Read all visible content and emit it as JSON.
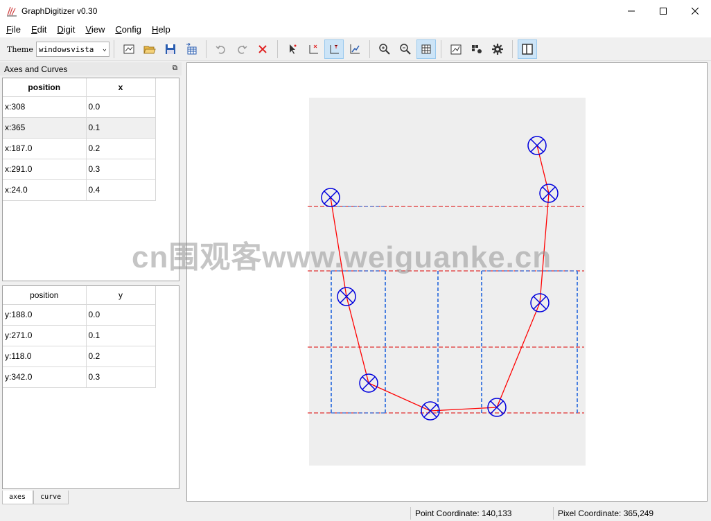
{
  "window": {
    "title": "GraphDigitizer v0.30"
  },
  "menu": [
    {
      "label_pre": "",
      "label_ul": "F",
      "label_post": "ile"
    },
    {
      "label_pre": "",
      "label_ul": "E",
      "label_post": "dit"
    },
    {
      "label_pre": "",
      "label_ul": "D",
      "label_post": "igit"
    },
    {
      "label_pre": "",
      "label_ul": "V",
      "label_post": "iew"
    },
    {
      "label_pre": "",
      "label_ul": "C",
      "label_post": "onfig"
    },
    {
      "label_pre": "",
      "label_ul": "H",
      "label_post": "elp"
    }
  ],
  "toolbar": {
    "theme_label": "Theme",
    "theme_value": "windowsvista"
  },
  "dock": {
    "title": "Axes and Curves"
  },
  "x_table": {
    "headers": [
      "position",
      "x"
    ],
    "rows": [
      [
        "x:308",
        "0.0"
      ],
      [
        "x:365",
        "0.1"
      ],
      [
        "x:187.0",
        "0.2"
      ],
      [
        "x:291.0",
        "0.3"
      ],
      [
        "x:24.0",
        "0.4"
      ]
    ]
  },
  "y_table": {
    "headers": [
      "position",
      "y"
    ],
    "rows": [
      [
        "y:188.0",
        "0.0"
      ],
      [
        "y:271.0",
        "0.1"
      ],
      [
        "y:118.0",
        "0.2"
      ],
      [
        "y:342.0",
        "0.3"
      ]
    ]
  },
  "tabs": [
    "axes",
    "curve"
  ],
  "status": {
    "point": "Point Coordinate: 140,133",
    "pixel": "Pixel Coordinate: 365,249"
  },
  "watermark": "cn围观客www.weiguanke.cn",
  "colors": {
    "curve": "#ff0000",
    "marker": "#0000dd",
    "axis_h": "#e03030",
    "axis_v": "#4a80e0",
    "plot_bg": "#eeeeee"
  }
}
